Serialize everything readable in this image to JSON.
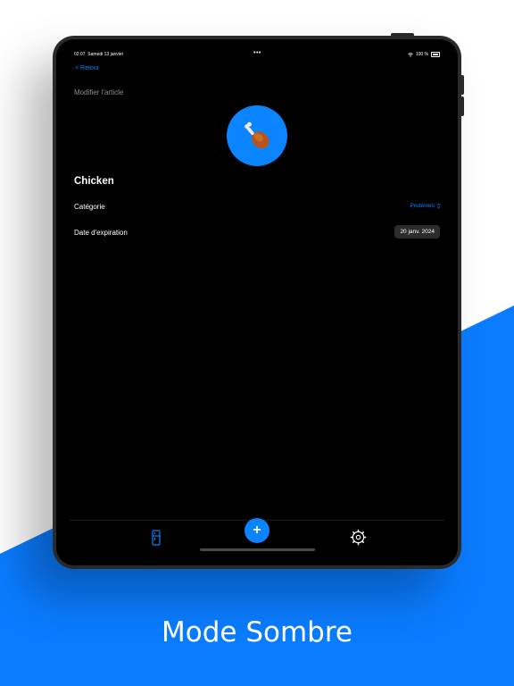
{
  "status_bar": {
    "time": "02:07",
    "date": "Samedi 13 janvier",
    "dots": "•••",
    "battery": "100 %"
  },
  "nav": {
    "back_label": "< Retour",
    "title": "Modifier l'article"
  },
  "item": {
    "icon": "poultry-leg-icon",
    "name": "Chicken"
  },
  "rows": {
    "category_label": "Catégorie",
    "category_value": "Protéines",
    "expiration_label": "Date d'expiration",
    "expiration_value": "20 janv. 2024"
  },
  "tab_bar": {
    "fridge_icon": "fridge-icon",
    "add_label": "+",
    "settings_icon": "gear-icon"
  },
  "caption": "Mode Sombre",
  "colors": {
    "accent": "#0a84ff",
    "background_blue": "#0a7cff",
    "screen": "#000000",
    "pill": "#2c2c2e"
  }
}
